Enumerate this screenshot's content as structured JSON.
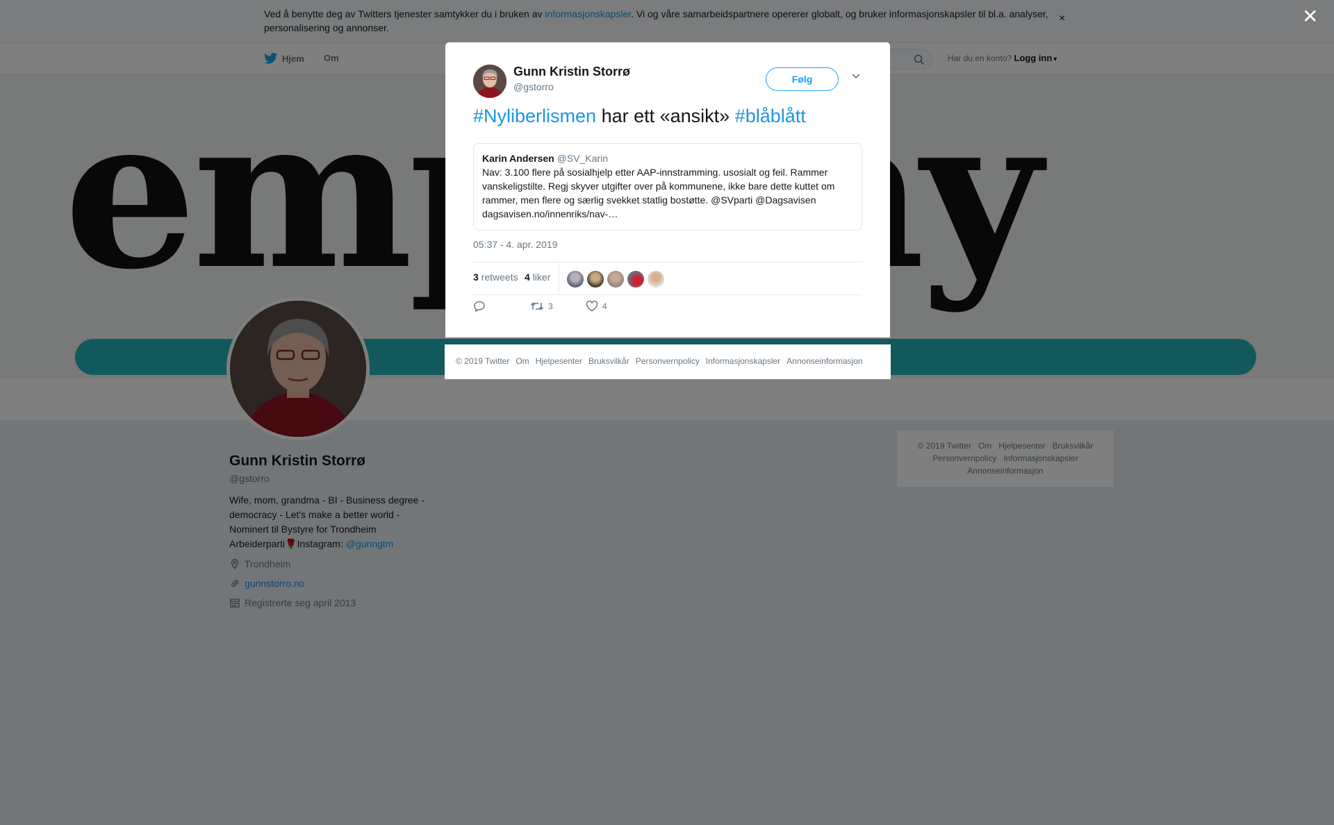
{
  "cookie": {
    "text_before": "Ved å benytte deg av Twitters tjenester samtykker du i bruken av ",
    "link": "informasjonskapsler",
    "text_after": ". Vi og våre samarbeidspartnere opererer globalt, og bruker informasjonskapsler til bl.a. analyser, personalisering og annonser.",
    "close": "×"
  },
  "nav": {
    "home": "Hjem",
    "about": "Om",
    "login_prompt": "Har du en konto?",
    "login": "Logg inn"
  },
  "banner": {
    "word": "empathy"
  },
  "profile": {
    "name": "Gunn Kristin Storrø",
    "handle": "@gstorro",
    "bio": "Wife, mom, grandma - BI - Business degree - democracy - Let's make a better world - Nominert til Bystyre for Trondheim Arbeiderparti",
    "bio_emoji": "🌹",
    "bio_instagram": "Instagram: ",
    "bio_link": "@gunngtm",
    "location": "Trondheim",
    "website": "gunnstorro.no",
    "joined": "Registrerte seg april 2013"
  },
  "side_footer": {
    "items": [
      "© 2019 Twitter",
      "Om",
      "Hjelpesenter",
      "Bruksvilkår",
      "Personvernpolicy",
      "Informasjonskapsler",
      "Annonseinformasjon"
    ]
  },
  "modal": {
    "close": "✕",
    "name": "Gunn Kristin Storrø",
    "handle": "@gstorro",
    "follow": "Følg",
    "tweet": {
      "tag1": "#Nyliberlismen",
      "middle": " har ett «ansikt» ",
      "tag2": "#blåblått"
    },
    "quote": {
      "name": "Karin Andersen",
      "handle": "@SV_Karin",
      "text": "Nav: 3.100 flere på sosialhjelp etter AAP-innstramming. usosialt og feil. Rammer vanskeligstilte. Regj skyver utgifter over på kommunene, ikke bare dette kuttet om rammer, men flere og særlig svekket statlig bostøtte. @SVparti @Dagsavisen dagsavisen.no/innenriks/nav-…"
    },
    "time": "05:37 - 4. apr. 2019",
    "retweets_count": "3",
    "retweets_label": "retweets",
    "likes_count": "4",
    "likes_label": "liker",
    "action_retweets": "3",
    "action_likes": "4"
  },
  "modal_footer": {
    "items": [
      "© 2019 Twitter",
      "Om",
      "Hjelpesenter",
      "Bruksvilkår",
      "Personvernpolicy",
      "Informasjonskapsler",
      "Annonseinformasjon"
    ]
  },
  "colors": {
    "link": "#1b95e0",
    "accent": "#1da1f2",
    "overlay": "rgba(0,0,0,0.5)"
  }
}
